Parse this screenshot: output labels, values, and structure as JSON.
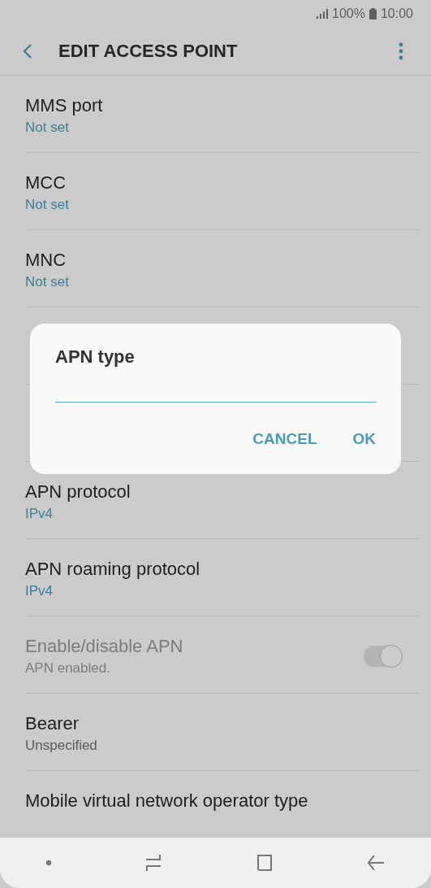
{
  "status_bar": {
    "battery": "100%",
    "time": "10:00"
  },
  "app_bar": {
    "title": "EDIT ACCESS POINT"
  },
  "rows": [
    {
      "kind": "value",
      "title": "MMS port",
      "value": "Not set",
      "disabled": false
    },
    {
      "kind": "value",
      "title": "MCC",
      "value": "Not set",
      "disabled": false
    },
    {
      "kind": "value",
      "title": "MNC",
      "value": "Not set",
      "disabled": false
    },
    {
      "kind": "covered"
    },
    {
      "kind": "covered"
    },
    {
      "kind": "value",
      "title": "APN protocol",
      "value": "IPv4",
      "disabled": false
    },
    {
      "kind": "value",
      "title": "APN roaming protocol",
      "value": "IPv4",
      "disabled": false
    },
    {
      "kind": "switch",
      "title": "Enable/disable APN",
      "value": "APN enabled.",
      "disabled": true,
      "on": true
    },
    {
      "kind": "plain",
      "title": "Bearer",
      "value": "Unspecified",
      "disabled": false
    },
    {
      "kind": "plain",
      "title": "Mobile virtual network operator type",
      "disabled": false
    }
  ],
  "dialog": {
    "title": "APN type",
    "buttons": [
      "CANCEL",
      "OK"
    ]
  }
}
